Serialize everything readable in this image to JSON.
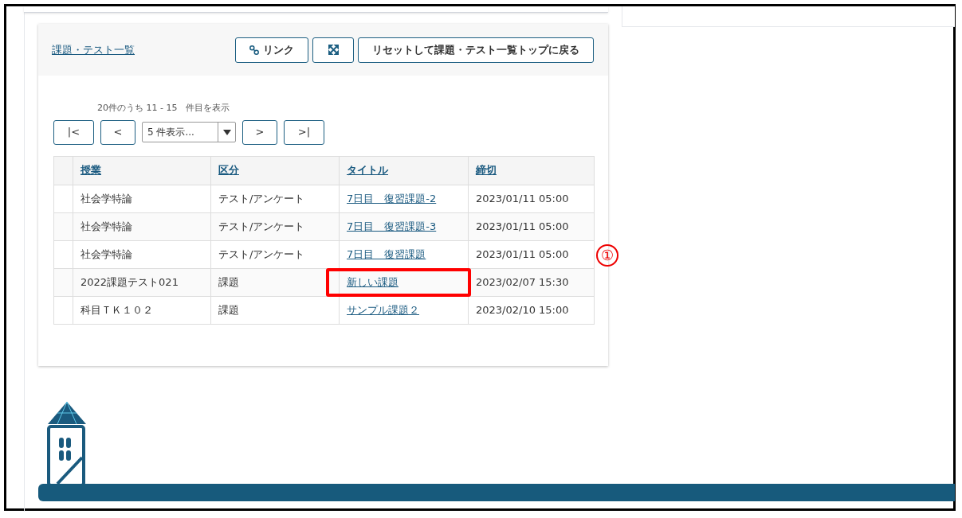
{
  "card": {
    "breadcrumb": "課題・テスト一覧",
    "buttons": [
      {
        "kind": "link",
        "label": "リンク"
      },
      {
        "kind": "expand"
      },
      {
        "kind": "text",
        "label": "リセットして課題・テスト一覧トップに戻る"
      }
    ]
  },
  "pager": {
    "summary": "20件のうち 11 - 15　件目を表示",
    "first": "|<",
    "prev": "<",
    "page_size": "5 件表示...",
    "next": ">",
    "last": ">|"
  },
  "table": {
    "columns": [
      "授業",
      "区分",
      "タイトル",
      "締切"
    ],
    "rows": [
      {
        "course": "社会学特論",
        "type": "テスト/アンケート",
        "title": "7日目　復習課題-2",
        "deadline": "2023/01/11 05:00",
        "highlighted": false
      },
      {
        "course": "社会学特論",
        "type": "テスト/アンケート",
        "title": "7日目　復習課題-3",
        "deadline": "2023/01/11 05:00",
        "highlighted": false
      },
      {
        "course": "社会学特論",
        "type": "テスト/アンケート",
        "title": "7日目　復習課題",
        "deadline": "2023/01/11 05:00",
        "highlighted": false
      },
      {
        "course": "2022課題テスト021",
        "type": "課題",
        "title": "新しい課題",
        "deadline": "2023/02/07 15:30",
        "highlighted": true
      },
      {
        "course": "科目ＴＫ１０２",
        "type": "課題",
        "title": "サンプル課題２",
        "deadline": "2023/02/10 15:00",
        "highlighted": false
      }
    ]
  },
  "annotation": {
    "marker": "①"
  }
}
